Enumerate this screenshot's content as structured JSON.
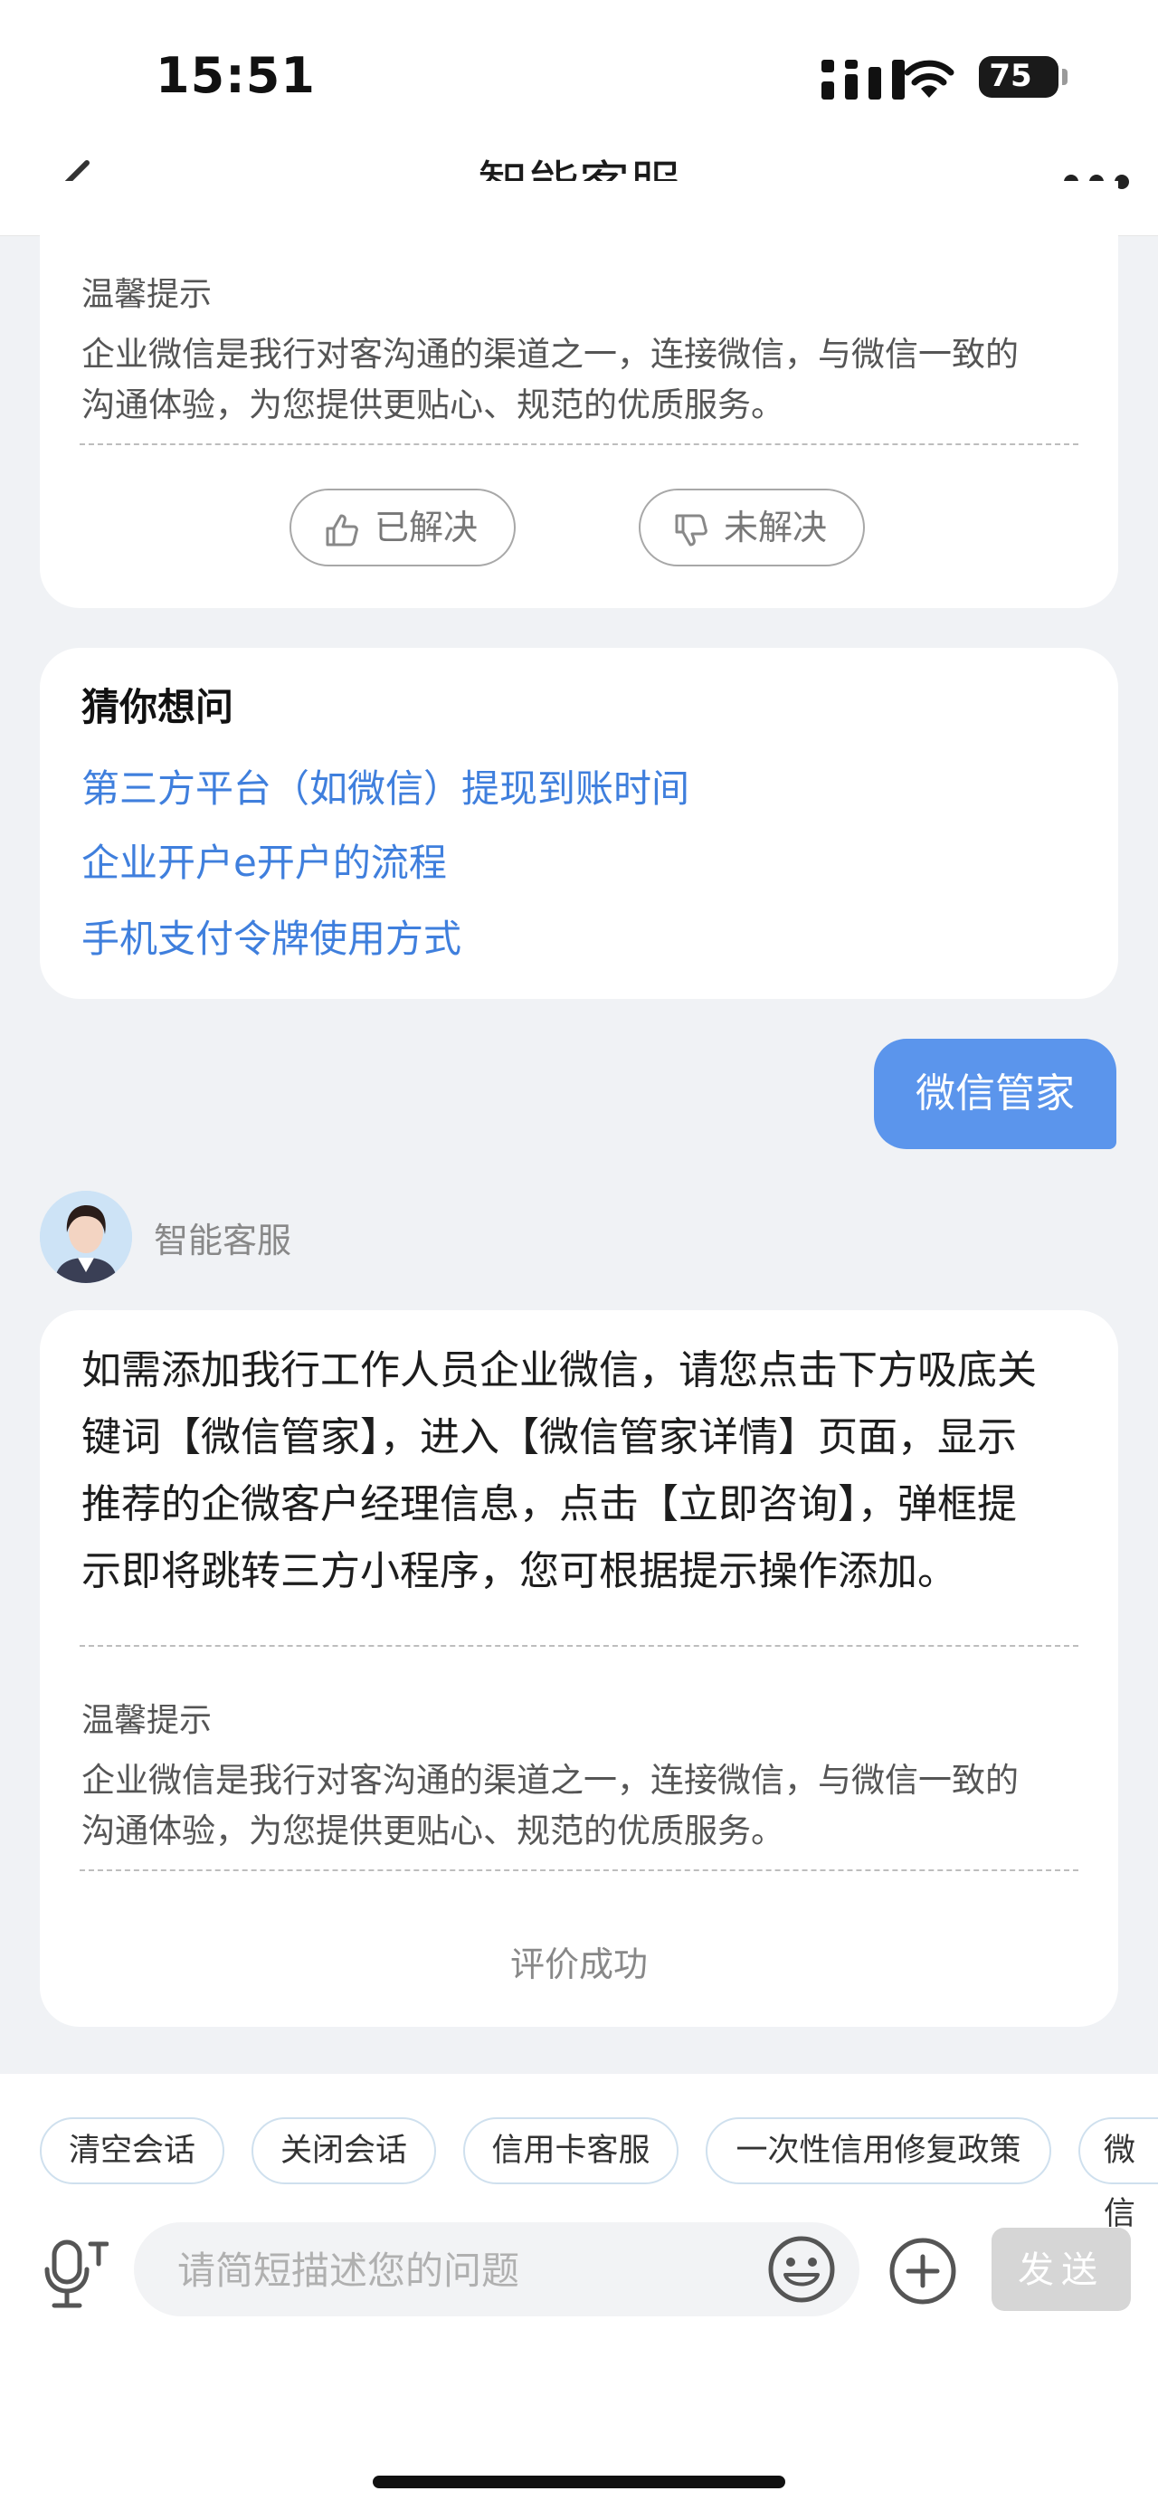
{
  "status_bar": {
    "time": "15:51",
    "battery": "75"
  },
  "nav": {
    "title": "智能客服"
  },
  "first_card": {
    "tip_title": "温馨提示",
    "tip_text_line1": "企业微信是我行对客沟通的渠道之一，连接微信，与微信一致的",
    "tip_text_line2": "沟通体验，为您提供更贴心、规范的优质服务。",
    "resolved_label": "已解决",
    "unresolved_label": "未解决"
  },
  "guess": {
    "title": "猜你想问",
    "links": [
      "第三方平台（如微信）提现到账时间",
      "企业开户e开户的流程",
      "手机支付令牌使用方式"
    ]
  },
  "user_message": "微信管家",
  "bot": {
    "name": "智能客服",
    "answer_lines": [
      "如需添加我行工作人员企业微信，请您点击下方吸底关",
      "键词【微信管家】，进入【微信管家详情】页面，显示",
      "推荐的企微客户经理信息，点击【立即咨询】，弹框提",
      "示即将跳转三方小程序，您可根据提示操作添加。"
    ],
    "tip_title": "温馨提示",
    "tip_text_line1": "企业微信是我行对客沟通的渠道之一，连接微信，与微信一致的",
    "tip_text_line2": "沟通体验，为您提供更贴心、规范的优质服务。",
    "evaluation": "评价成功"
  },
  "quick_chips": [
    "清空会话",
    "关闭会话",
    "信用卡客服",
    "一次性信用修复政策",
    "微信"
  ],
  "input": {
    "placeholder": "请简短描述您的问题",
    "value": ""
  },
  "send_label": "发送",
  "colors": {
    "accent": "#5b95ec",
    "link": "#3f7fdd",
    "background": "#f0f2f5"
  }
}
